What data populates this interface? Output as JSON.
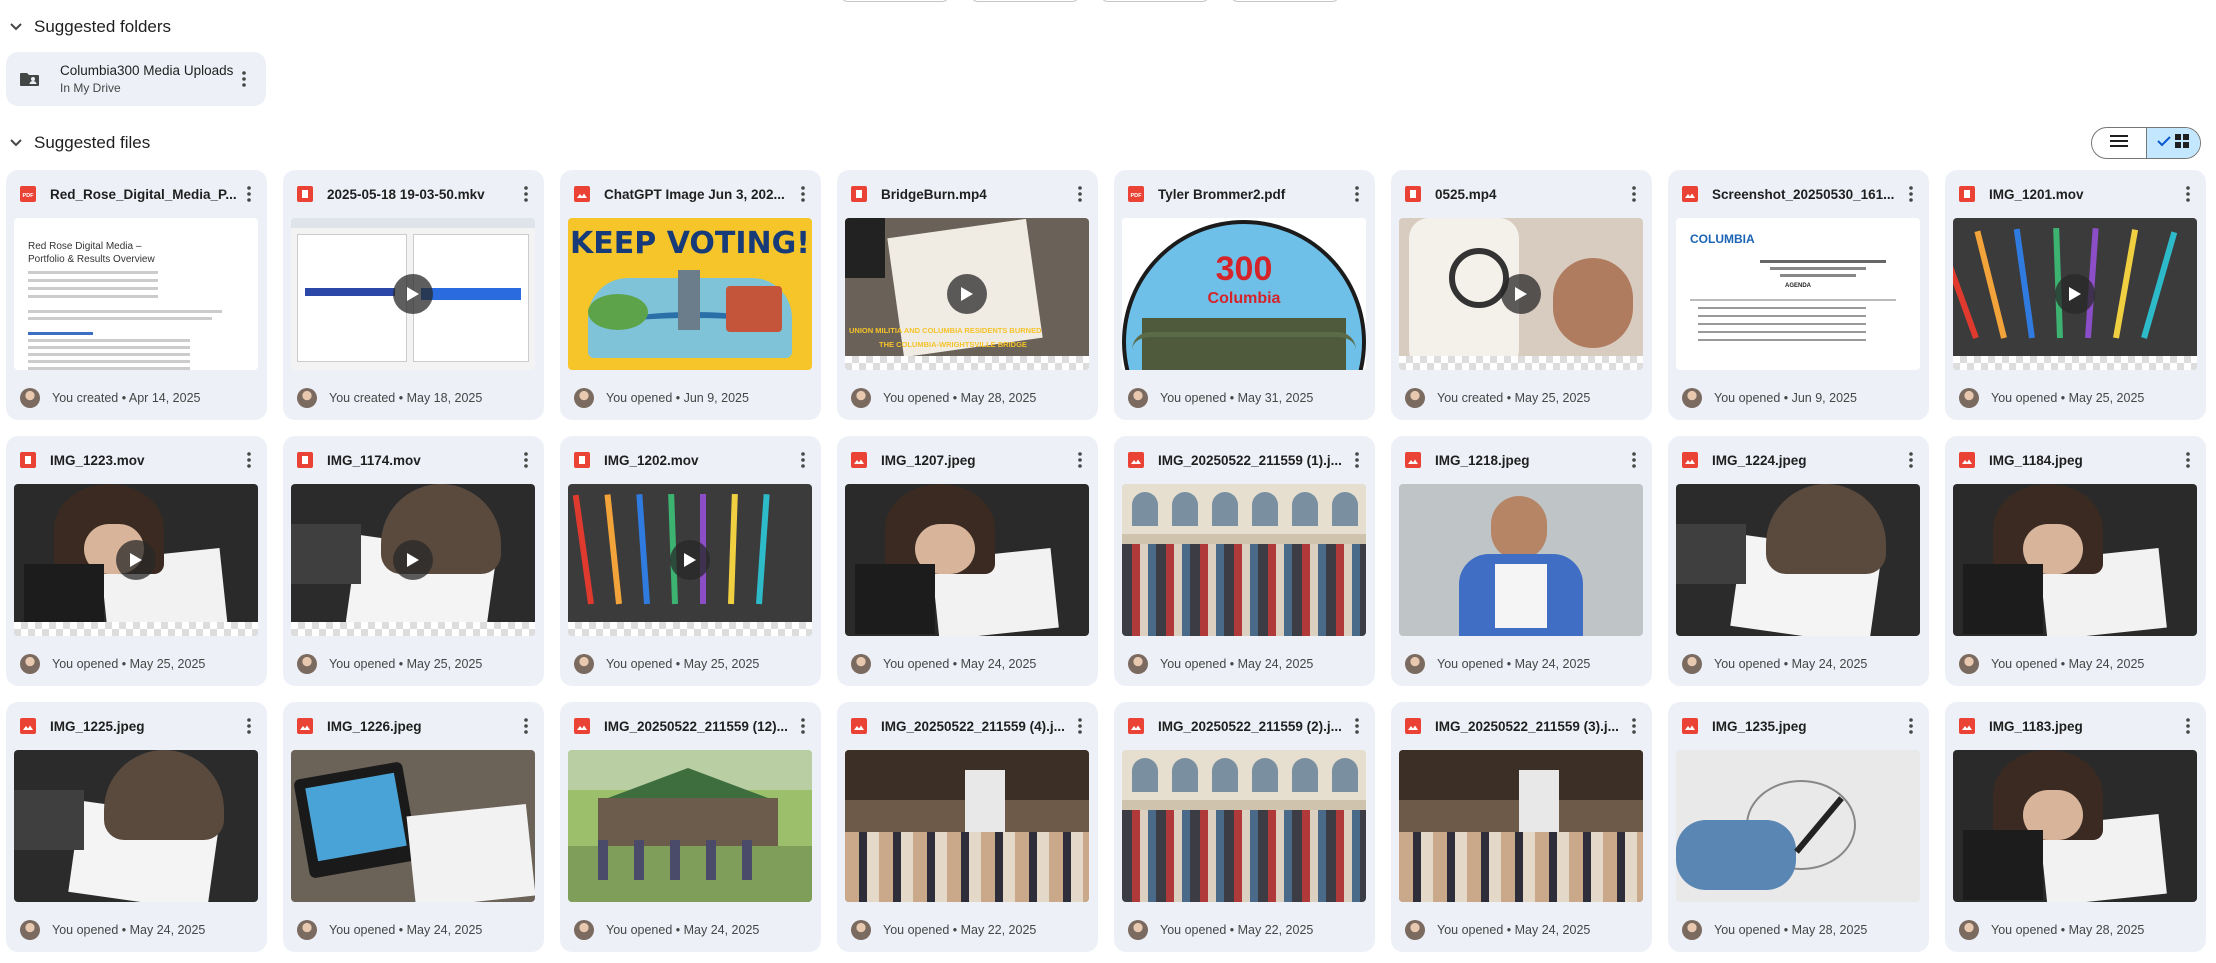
{
  "folders_section": {
    "title": "Suggested folders"
  },
  "folder": {
    "name": "Columbia300 Media Uploads",
    "location": "In My Drive"
  },
  "files_section": {
    "title": "Suggested files"
  },
  "files": [
    {
      "name": "Red_Rose_Digital_Media_P...",
      "type": "pdf",
      "meta": "You created • Apr 14, 2025",
      "video": false,
      "thumb": "doc",
      "doc_title": "Red Rose Digital Media – Portfolio & Results Overview"
    },
    {
      "name": "2025-05-18 19-03-50.mkv",
      "type": "video",
      "meta": "You created • May 18, 2025",
      "video": true,
      "thumb": "screen"
    },
    {
      "name": "ChatGPT Image Jun 3, 202...",
      "type": "image",
      "meta": "You opened • Jun 9, 2025",
      "video": false,
      "thumb": "poster",
      "poster_text": "KEEP VOTING!"
    },
    {
      "name": "BridgeBurn.mp4",
      "type": "video",
      "meta": "You opened • May 28, 2025",
      "video": true,
      "thumb": "bridgeburn",
      "caption_a": "UNION MILITIA AND COLUMBIA RESIDENTS BURNED",
      "caption_b": "THE COLUMBIA-WRIGHTSVILLE BRIDGE"
    },
    {
      "name": "Tyler Brommer2.pdf",
      "type": "pdf",
      "meta": "You opened • May 31, 2025",
      "video": false,
      "thumb": "logo300",
      "logo_num": "300",
      "logo_word": "Columbia"
    },
    {
      "name": "0525.mp4",
      "type": "video",
      "meta": "You created • May 25, 2025",
      "video": true,
      "thumb": "warm"
    },
    {
      "name": "Screenshot_20250530_161...",
      "type": "image",
      "meta": "You opened • Jun 9, 2025",
      "video": false,
      "thumb": "agenda",
      "agenda_brand": "COLUMBIA",
      "agenda_heading": "AGENDA"
    },
    {
      "name": "IMG_1201.mov",
      "type": "video",
      "meta": "You opened • May 25, 2025",
      "video": true,
      "thumb": "pencils"
    },
    {
      "name": "IMG_1223.mov",
      "type": "video",
      "meta": "You opened • May 25, 2025",
      "video": true,
      "thumb": "drawing"
    },
    {
      "name": "IMG_1174.mov",
      "type": "video",
      "meta": "You opened • May 25, 2025",
      "video": true,
      "thumb": "drawing2"
    },
    {
      "name": "IMG_1202.mov",
      "type": "video",
      "meta": "You opened • May 25, 2025",
      "video": true,
      "thumb": "pencils2"
    },
    {
      "name": "IMG_1207.jpeg",
      "type": "image",
      "meta": "You opened • May 24, 2025",
      "video": false,
      "thumb": "drawing"
    },
    {
      "name": "IMG_20250522_211559 (1).j...",
      "type": "image",
      "meta": "You opened • May 24, 2025",
      "video": false,
      "thumb": "crowd"
    },
    {
      "name": "IMG_1218.jpeg",
      "type": "image",
      "meta": "You opened • May 24, 2025",
      "video": false,
      "thumb": "person"
    },
    {
      "name": "IMG_1224.jpeg",
      "type": "image",
      "meta": "You opened • May 24, 2025",
      "video": false,
      "thumb": "drawing2"
    },
    {
      "name": "IMG_1184.jpeg",
      "type": "image",
      "meta": "You opened • May 24, 2025",
      "video": false,
      "thumb": "drawing"
    },
    {
      "name": "IMG_1225.jpeg",
      "type": "image",
      "meta": "You opened • May 24, 2025",
      "video": false,
      "thumb": "drawing2"
    },
    {
      "name": "IMG_1226.jpeg",
      "type": "image",
      "meta": "You opened • May 24, 2025",
      "video": false,
      "thumb": "tablet"
    },
    {
      "name": "IMG_20250522_211559 (12)...",
      "type": "image",
      "meta": "You opened • May 24, 2025",
      "video": false,
      "thumb": "park"
    },
    {
      "name": "IMG_20250522_211559 (4).j...",
      "type": "image",
      "meta": "You opened • May 22, 2025",
      "video": false,
      "thumb": "hall"
    },
    {
      "name": "IMG_20250522_211559 (2).j...",
      "type": "image",
      "meta": "You opened • May 22, 2025",
      "video": false,
      "thumb": "crowd"
    },
    {
      "name": "IMG_20250522_211559 (3).j...",
      "type": "image",
      "meta": "You opened • May 24, 2025",
      "video": false,
      "thumb": "hall"
    },
    {
      "name": "IMG_1235.jpeg",
      "type": "image",
      "meta": "You opened • May 28, 2025",
      "video": false,
      "thumb": "sketch"
    },
    {
      "name": "IMG_1183.jpeg",
      "type": "image",
      "meta": "You opened • May 28, 2025",
      "video": false,
      "thumb": "drawing"
    }
  ],
  "colors": {
    "card_bg": "#edf1f7",
    "pdf_red": "#ea4335",
    "toggle_selected": "#c2e7ff"
  },
  "icons": {
    "collapse": "chevron-down-icon",
    "folder": "shared-folder-icon",
    "more": "more-vert-icon",
    "list_view": "list-view-icon",
    "grid_view": "grid-view-icon",
    "check": "check-icon",
    "play": "play-icon"
  }
}
